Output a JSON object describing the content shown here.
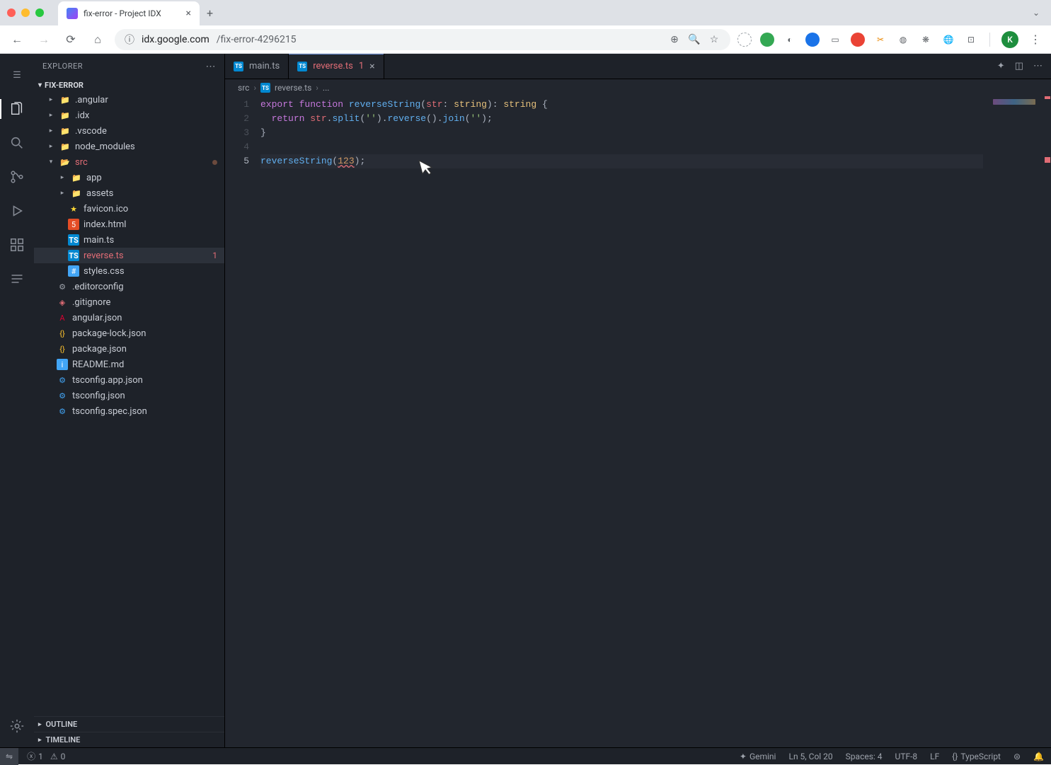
{
  "browser": {
    "tab_title": "fix-error - Project IDX",
    "url_host": "idx.google.com",
    "url_path": "/fix-error-4296215",
    "avatar_letter": "K"
  },
  "sidebar": {
    "title": "EXPLORER",
    "project": "FIX-ERROR",
    "outline": "OUTLINE",
    "timeline": "TIMELINE",
    "tree": {
      "angular": ".angular",
      "idx": ".idx",
      "vscode": ".vscode",
      "node_modules": "node_modules",
      "src": "src",
      "app": "app",
      "assets": "assets",
      "favicon": "favicon.ico",
      "indexhtml": "index.html",
      "maints": "main.ts",
      "reversets": "reverse.ts",
      "reversets_badge": "1",
      "stylescss": "styles.css",
      "editorconfig": ".editorconfig",
      "gitignore": ".gitignore",
      "angularjson": "angular.json",
      "packagelock": "package-lock.json",
      "packagejson": "package.json",
      "readme": "README.md",
      "tsconfapp": "tsconfig.app.json",
      "tsconf": "tsconfig.json",
      "tsconfspec": "tsconfig.spec.json"
    }
  },
  "tabs": {
    "main": "main.ts",
    "reverse": "reverse.ts",
    "reverse_badge": "1"
  },
  "breadcrumb": {
    "a": "src",
    "b": "reverse.ts",
    "c": "..."
  },
  "code": {
    "l1": {
      "export": "export",
      "function": "function",
      "name": "reverseString",
      "open": "(",
      "param": "str",
      "colon": ": ",
      "ptype": "string",
      "close": "): ",
      "rtype": "string",
      "brace": " {"
    },
    "l2": {
      "indent": "  ",
      "return": "return",
      "sp": " ",
      "v": "str",
      "dot1": ".",
      "m1": "split",
      "p1": "(",
      "s1": "''",
      "pc1": ").",
      "m2": "reverse",
      "p2": "().",
      "m3": "join",
      "p3": "(",
      "s2": "''",
      "pc3": ");"
    },
    "l3": "}",
    "l5": {
      "call": "reverseString",
      "open": "(",
      "arg": "123",
      "close": ");"
    }
  },
  "status": {
    "errors": "1",
    "warnings": "0",
    "gemini": "Gemini",
    "lncol": "Ln 5, Col 20",
    "spaces": "Spaces: 4",
    "encoding": "UTF-8",
    "eol": "LF",
    "lang": "TypeScript"
  }
}
